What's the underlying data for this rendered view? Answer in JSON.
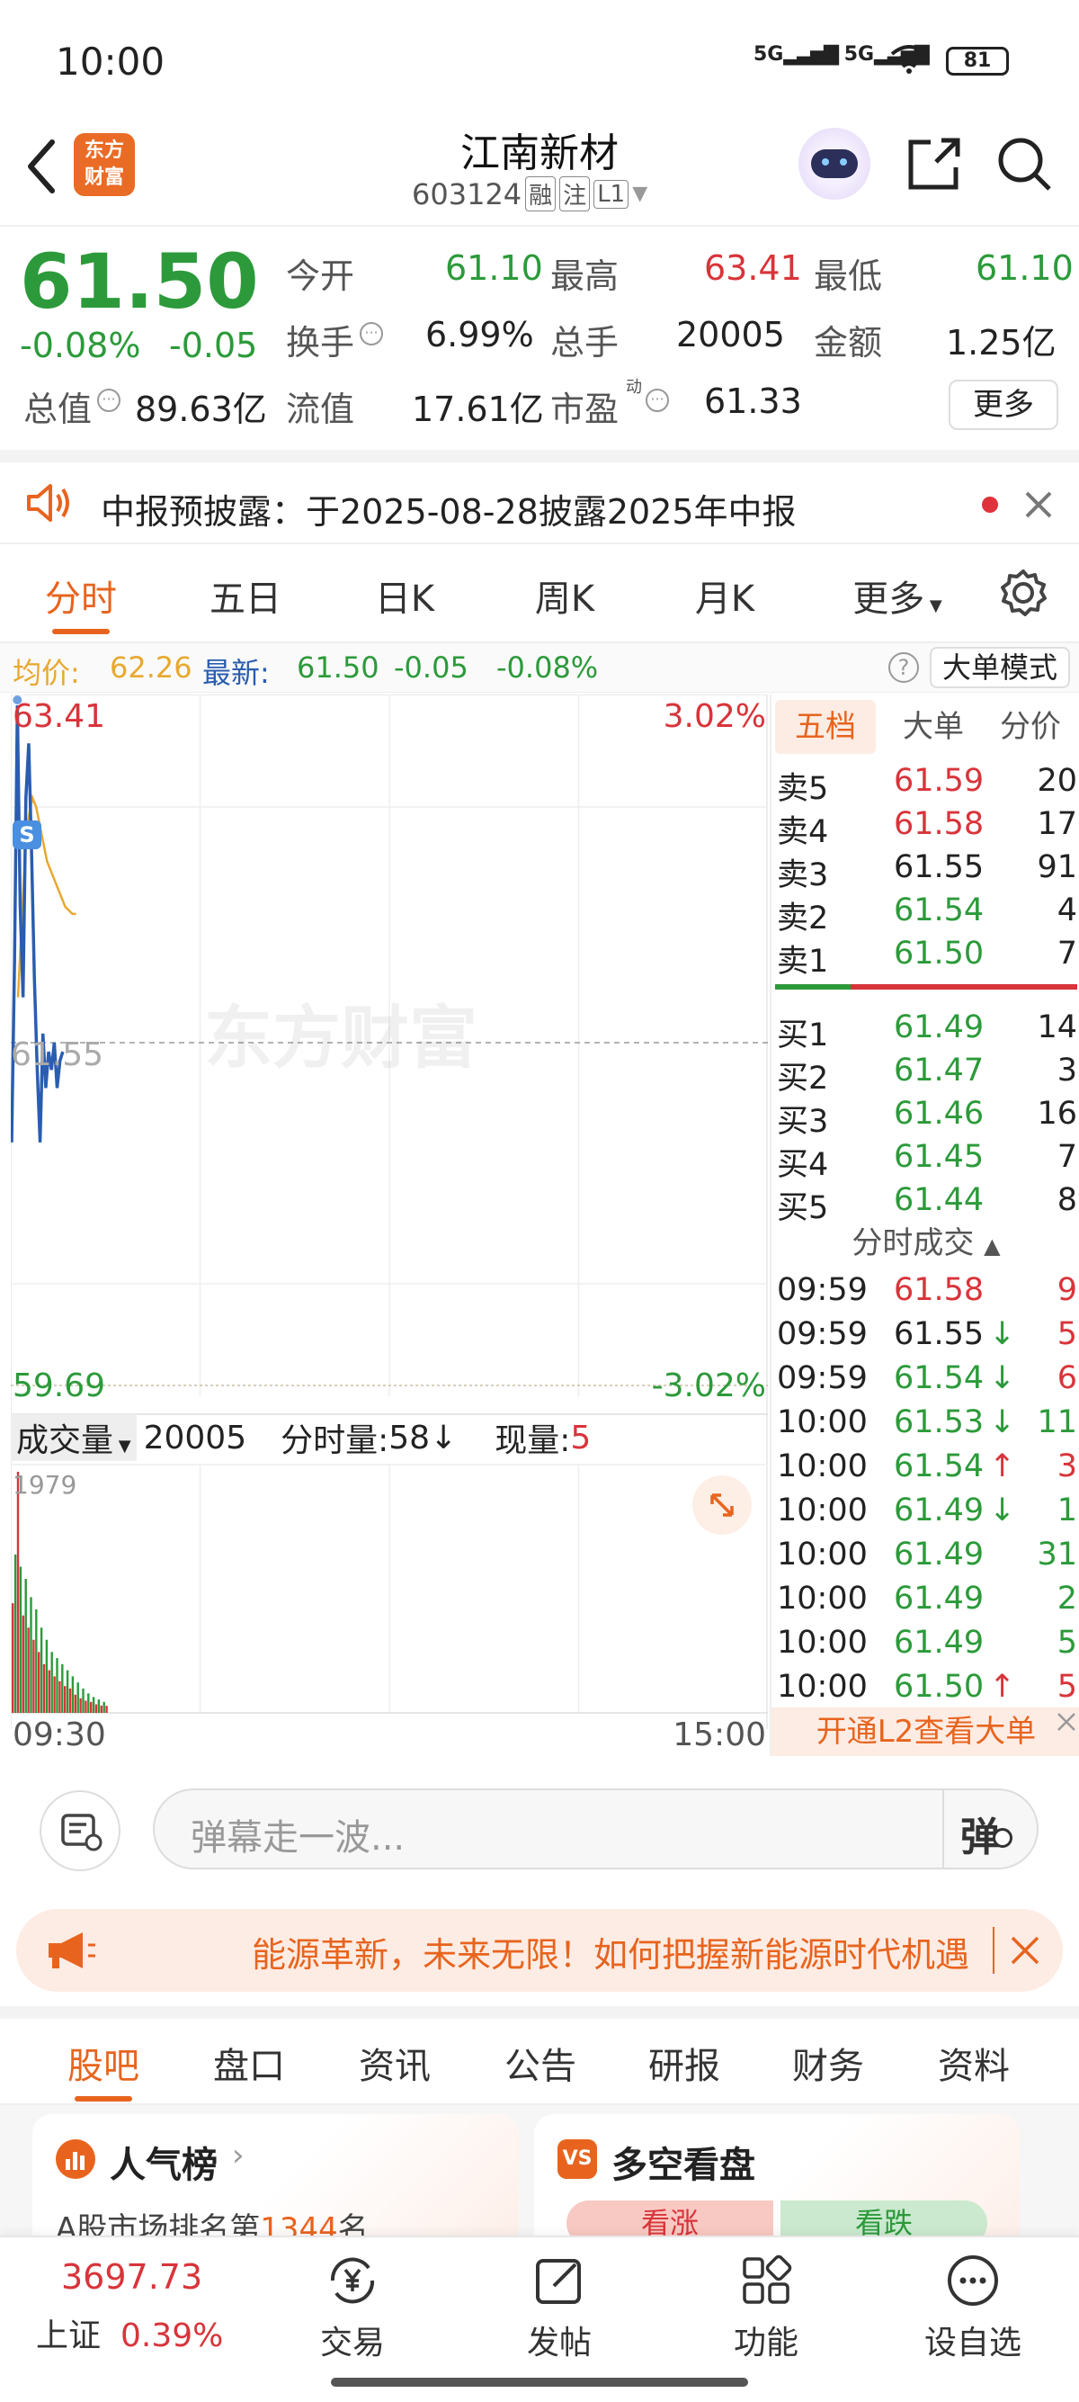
{
  "status_bar": {
    "time": "10:00",
    "network": "5G",
    "battery": "81"
  },
  "header": {
    "title": "江南新材",
    "code": "603124",
    "tags": [
      "融",
      "注",
      "L1"
    ],
    "logo_text_1": "东方",
    "logo_text_2": "财富"
  },
  "quote": {
    "price": "61.50",
    "change_pct": "-0.08%",
    "change": "-0.05",
    "fields": [
      {
        "label": "今开",
        "value": "61.10",
        "color": "green"
      },
      {
        "label": "最高",
        "value": "63.41",
        "color": "red"
      },
      {
        "label": "最低",
        "value": "61.10",
        "color": "green"
      },
      {
        "label": "换手",
        "value": "6.99%",
        "color": "black"
      },
      {
        "label": "总手",
        "value": "20005",
        "color": "black"
      },
      {
        "label": "金额",
        "value": "1.25亿",
        "color": "black"
      },
      {
        "label": "总值",
        "value": "89.63亿",
        "color": "black"
      },
      {
        "label": "流值",
        "value": "17.61亿",
        "color": "black"
      },
      {
        "label": "市盈",
        "value": "61.33",
        "color": "black",
        "sup": "动"
      }
    ],
    "more_button": "更多"
  },
  "notice": {
    "text": "中报预披露：于2025-08-28披露2025年中报"
  },
  "tabs": [
    "分时",
    "五日",
    "日K",
    "周K",
    "月K",
    "更多"
  ],
  "info_bar": {
    "avg_label": "均价:",
    "avg_value": "62.26",
    "latest_label": "最新:",
    "latest_value": "61.50",
    "change": "-0.05",
    "change_pct": "-0.08%",
    "big_order_button": "大单模式"
  },
  "chart_labels": {
    "top_price": "63.41",
    "top_pct": "3.02%",
    "mid_price": "61.55",
    "bottom_price": "59.69",
    "bottom_pct": "-3.02%",
    "watermark": "东方财富",
    "s_marker": "S",
    "start_time": "09:30",
    "end_time": "15:00"
  },
  "volume_bar": {
    "label": "成交量",
    "total": "20005",
    "minute_label": "分时量:",
    "minute_value": "58",
    "current_label": "现量:",
    "current_value": "5",
    "max_label": "1979"
  },
  "orderbook": {
    "tabs": [
      "五档",
      "大单",
      "分价"
    ],
    "asks": [
      {
        "label": "卖5",
        "price": "61.59",
        "vol": "20",
        "color": "red"
      },
      {
        "label": "卖4",
        "price": "61.58",
        "vol": "17",
        "color": "red"
      },
      {
        "label": "卖3",
        "price": "61.55",
        "vol": "91",
        "color": "black"
      },
      {
        "label": "卖2",
        "price": "61.54",
        "vol": "4",
        "color": "green"
      },
      {
        "label": "卖1",
        "price": "61.50",
        "vol": "7",
        "color": "green"
      }
    ],
    "bids": [
      {
        "label": "买1",
        "price": "61.49",
        "vol": "14",
        "color": "green"
      },
      {
        "label": "买2",
        "price": "61.47",
        "vol": "3",
        "color": "green"
      },
      {
        "label": "买3",
        "price": "61.46",
        "vol": "16",
        "color": "green"
      },
      {
        "label": "买4",
        "price": "61.45",
        "vol": "7",
        "color": "green"
      },
      {
        "label": "买5",
        "price": "61.44",
        "vol": "8",
        "color": "green"
      }
    ],
    "trades_title": "分时成交",
    "trades": [
      {
        "time": "09:59",
        "price": "61.58",
        "arrow": "",
        "vol": "9",
        "pcolor": "red",
        "vcolor": "red"
      },
      {
        "time": "09:59",
        "price": "61.55",
        "arrow": "↓",
        "vol": "5",
        "pcolor": "black",
        "vcolor": "red"
      },
      {
        "time": "09:59",
        "price": "61.54",
        "arrow": "↓",
        "vol": "6",
        "pcolor": "green",
        "vcolor": "red"
      },
      {
        "time": "10:00",
        "price": "61.53",
        "arrow": "↓",
        "vol": "11",
        "pcolor": "green",
        "vcolor": "green"
      },
      {
        "time": "10:00",
        "price": "61.54",
        "arrow": "↑",
        "vol": "3",
        "pcolor": "green",
        "vcolor": "red"
      },
      {
        "time": "10:00",
        "price": "61.49",
        "arrow": "↓",
        "vol": "1",
        "pcolor": "green",
        "vcolor": "green"
      },
      {
        "time": "10:00",
        "price": "61.49",
        "arrow": "",
        "vol": "31",
        "pcolor": "green",
        "vcolor": "green"
      },
      {
        "time": "10:00",
        "price": "61.49",
        "arrow": "",
        "vol": "2",
        "pcolor": "green",
        "vcolor": "green"
      },
      {
        "time": "10:00",
        "price": "61.49",
        "arrow": "",
        "vol": "5",
        "pcolor": "green",
        "vcolor": "green"
      },
      {
        "time": "10:00",
        "price": "61.50",
        "arrow": "↑",
        "vol": "5",
        "pcolor": "green",
        "vcolor": "red"
      }
    ],
    "l2_banner": "开通L2查看大单"
  },
  "comment": {
    "placeholder": "弹幕走一波...",
    "danmaku_button": "弹"
  },
  "banner": {
    "text": "能源革新，未来无限！如何把握新能源时代机遇"
  },
  "sub_tabs": [
    "股吧",
    "盘口",
    "资讯",
    "公告",
    "研报",
    "财务",
    "资料"
  ],
  "cards": {
    "popularity_title": "人气榜",
    "popularity_rank_prefix": "A股市场排名第",
    "popularity_rank": "1344",
    "popularity_rank_suffix": "名",
    "bullbear_title": "多空看盘",
    "bull_label": "看涨",
    "bear_label": "看跌"
  },
  "bottom_nav": {
    "index_value": "3697.73",
    "index_name": "上证",
    "index_pct": "0.39%",
    "items": [
      "交易",
      "发帖",
      "功能",
      "设自选"
    ]
  },
  "colors": {
    "up": "#d8343a",
    "down": "#2c9a3a",
    "accent": "#e8641e",
    "price_line": "#2a5db0",
    "avg_line": "#e8a830"
  },
  "chart_data": {
    "type": "line",
    "x_range": [
      "09:30",
      "15:00"
    ],
    "ylim": [
      59.69,
      63.41
    ],
    "reference_price": 61.55,
    "price_series": [
      61.0,
      62.0,
      63.41,
      62.3,
      61.8,
      62.9,
      63.2,
      62.6,
      61.9,
      61.4,
      61.0,
      61.6,
      61.3,
      61.5,
      61.4,
      61.55,
      61.3,
      61.45,
      61.5
    ],
    "avg_series": [
      61.8,
      62.2,
      62.6,
      62.8,
      62.9,
      62.85,
      62.75,
      62.65,
      62.55,
      62.5,
      62.45,
      62.4,
      62.35,
      62.3,
      62.28,
      62.26,
      62.26
    ],
    "volume_series": [
      900,
      1300,
      1979,
      1200,
      800,
      1100,
      700,
      950,
      600,
      850,
      500,
      700,
      400,
      600,
      350,
      500,
      300,
      450,
      260,
      400,
      220,
      350,
      200,
      300,
      150,
      250,
      120,
      200,
      100,
      160,
      90,
      130,
      70,
      110,
      60,
      90,
      58
    ],
    "volume_colors": [
      "red",
      "green",
      "red",
      "green",
      "red",
      "green",
      "red",
      "green",
      "red",
      "green",
      "red",
      "green",
      "red",
      "green",
      "red",
      "green",
      "red",
      "green",
      "red",
      "green",
      "red",
      "green",
      "red",
      "green",
      "red",
      "green",
      "red",
      "green",
      "red",
      "green",
      "red",
      "green",
      "red",
      "green",
      "red",
      "green",
      "red"
    ]
  }
}
